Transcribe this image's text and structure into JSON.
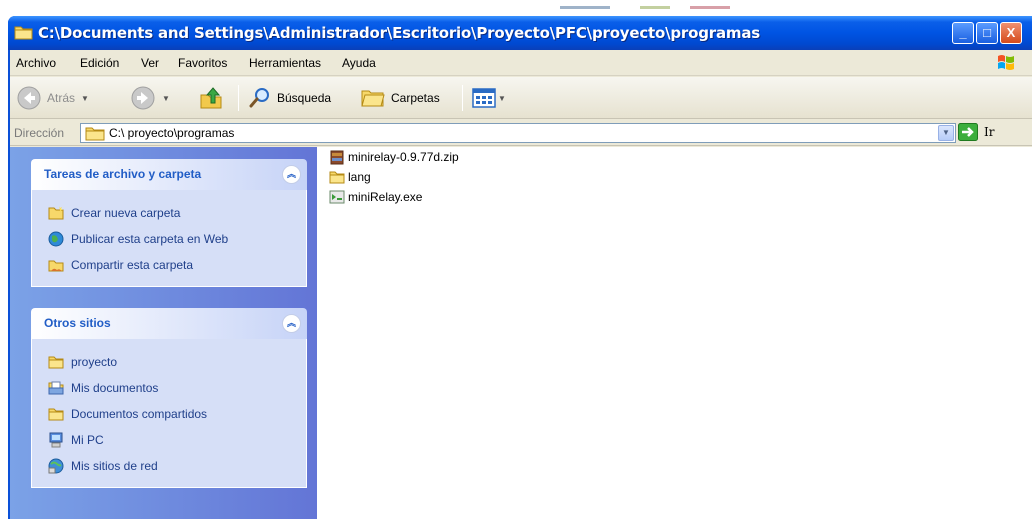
{
  "window": {
    "title": "C:\\Documents and Settings\\Administrador\\Escritorio\\Proyecto\\PFC\\proyecto\\programas",
    "min_label": "_",
    "max_label": "□",
    "close_label": "X"
  },
  "menubar": {
    "items": [
      "Archivo",
      "Edición",
      "Ver",
      "Favoritos",
      "Herramientas",
      "Ayuda"
    ]
  },
  "toolbar": {
    "back_label": "Atrás",
    "search_label": "Búsqueda",
    "folders_label": "Carpetas"
  },
  "addressbar": {
    "label": "Dirección",
    "value": "C:\\ proyecto\\programas",
    "go_label": "Ir"
  },
  "taskpane": {
    "file_tasks": {
      "title": "Tareas de archivo y carpeta",
      "items": [
        {
          "label": "Crear nueva carpeta",
          "icon": "new-folder-icon"
        },
        {
          "label": "Publicar esta carpeta en Web",
          "icon": "publish-web-icon"
        },
        {
          "label": "Compartir esta carpeta",
          "icon": "share-folder-icon"
        }
      ]
    },
    "other_places": {
      "title": "Otros sitios",
      "items": [
        {
          "label": "proyecto",
          "icon": "folder-icon"
        },
        {
          "label": "Mis documentos",
          "icon": "my-documents-icon"
        },
        {
          "label": "Documentos compartidos",
          "icon": "shared-documents-icon"
        },
        {
          "label": "Mi PC",
          "icon": "my-computer-icon"
        },
        {
          "label": "Mis sitios de red",
          "icon": "network-places-icon"
        }
      ]
    }
  },
  "files": [
    {
      "name": "minirelay-0.9.77d.zip",
      "icon": "zip-archive-icon"
    },
    {
      "name": "lang",
      "icon": "folder-icon"
    },
    {
      "name": "miniRelay.exe",
      "icon": "executable-icon"
    }
  ],
  "colors": {
    "title_bar": "#0054e3",
    "taskpane_start": "#7ba2e7",
    "taskpane_end": "#6375d6",
    "panel_title": "#215dc6",
    "task_link": "#1f3f8a"
  }
}
